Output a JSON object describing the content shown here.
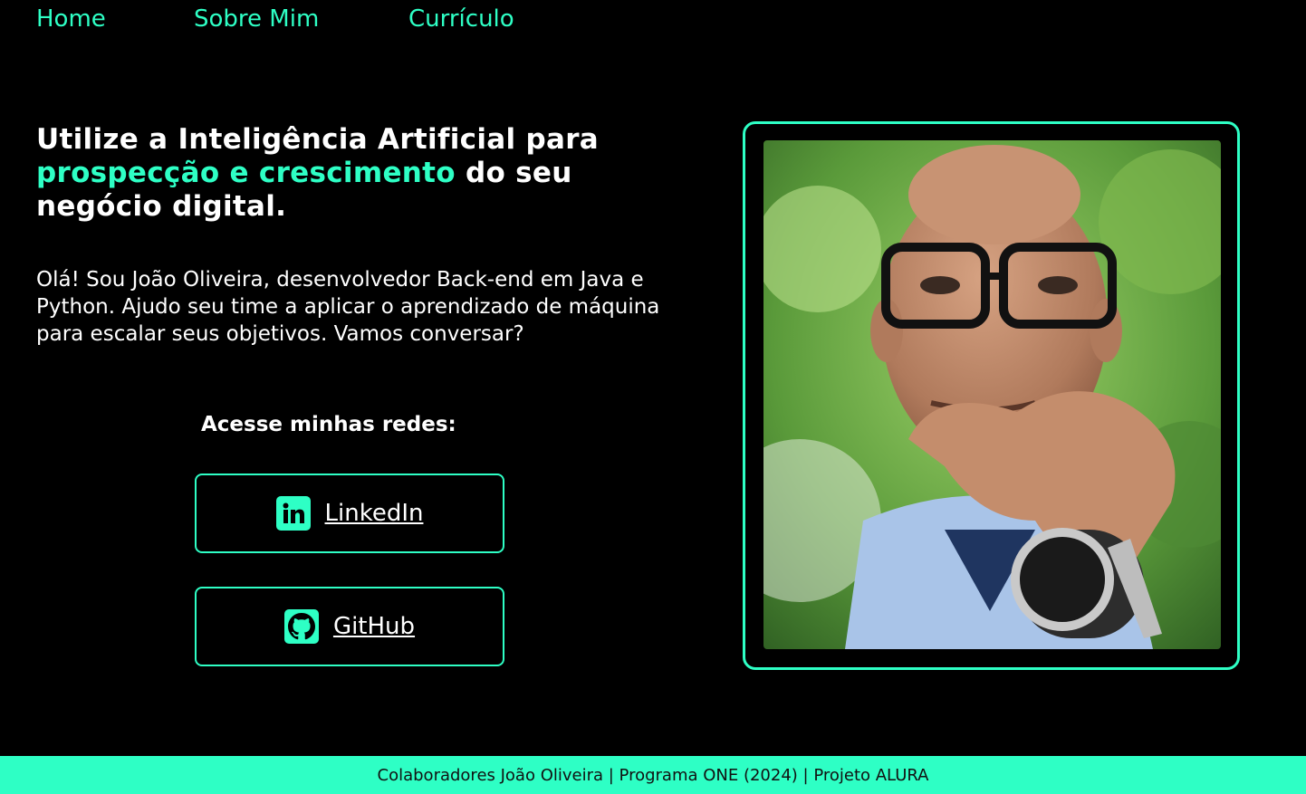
{
  "nav": {
    "items": [
      "Home",
      "Sobre Mim",
      "Currículo"
    ]
  },
  "hero": {
    "headline_part1": "Utilize a Inteligência Artificial para ",
    "headline_highlight": "prospecção e crescimento",
    "headline_part2": " do seu negócio digital.",
    "intro": "Olá! Sou João Oliveira, desenvolvedor Back-end em Java e Python. Ajudo seu time a aplicar o aprendizado de máquina para escalar seus objetivos. Vamos conversar?",
    "social_title": "Acesse minhas redes:",
    "buttons": [
      {
        "label": "LinkedIn",
        "icon": "linkedin-icon"
      },
      {
        "label": "GitHub",
        "icon": "github-icon"
      }
    ]
  },
  "footer": {
    "text": "Colaboradores João Oliveira | Programa ONE (2024) | Projeto ALURA"
  },
  "colors": {
    "accent": "#2effc5",
    "background": "#000000",
    "text": "#ffffff"
  }
}
